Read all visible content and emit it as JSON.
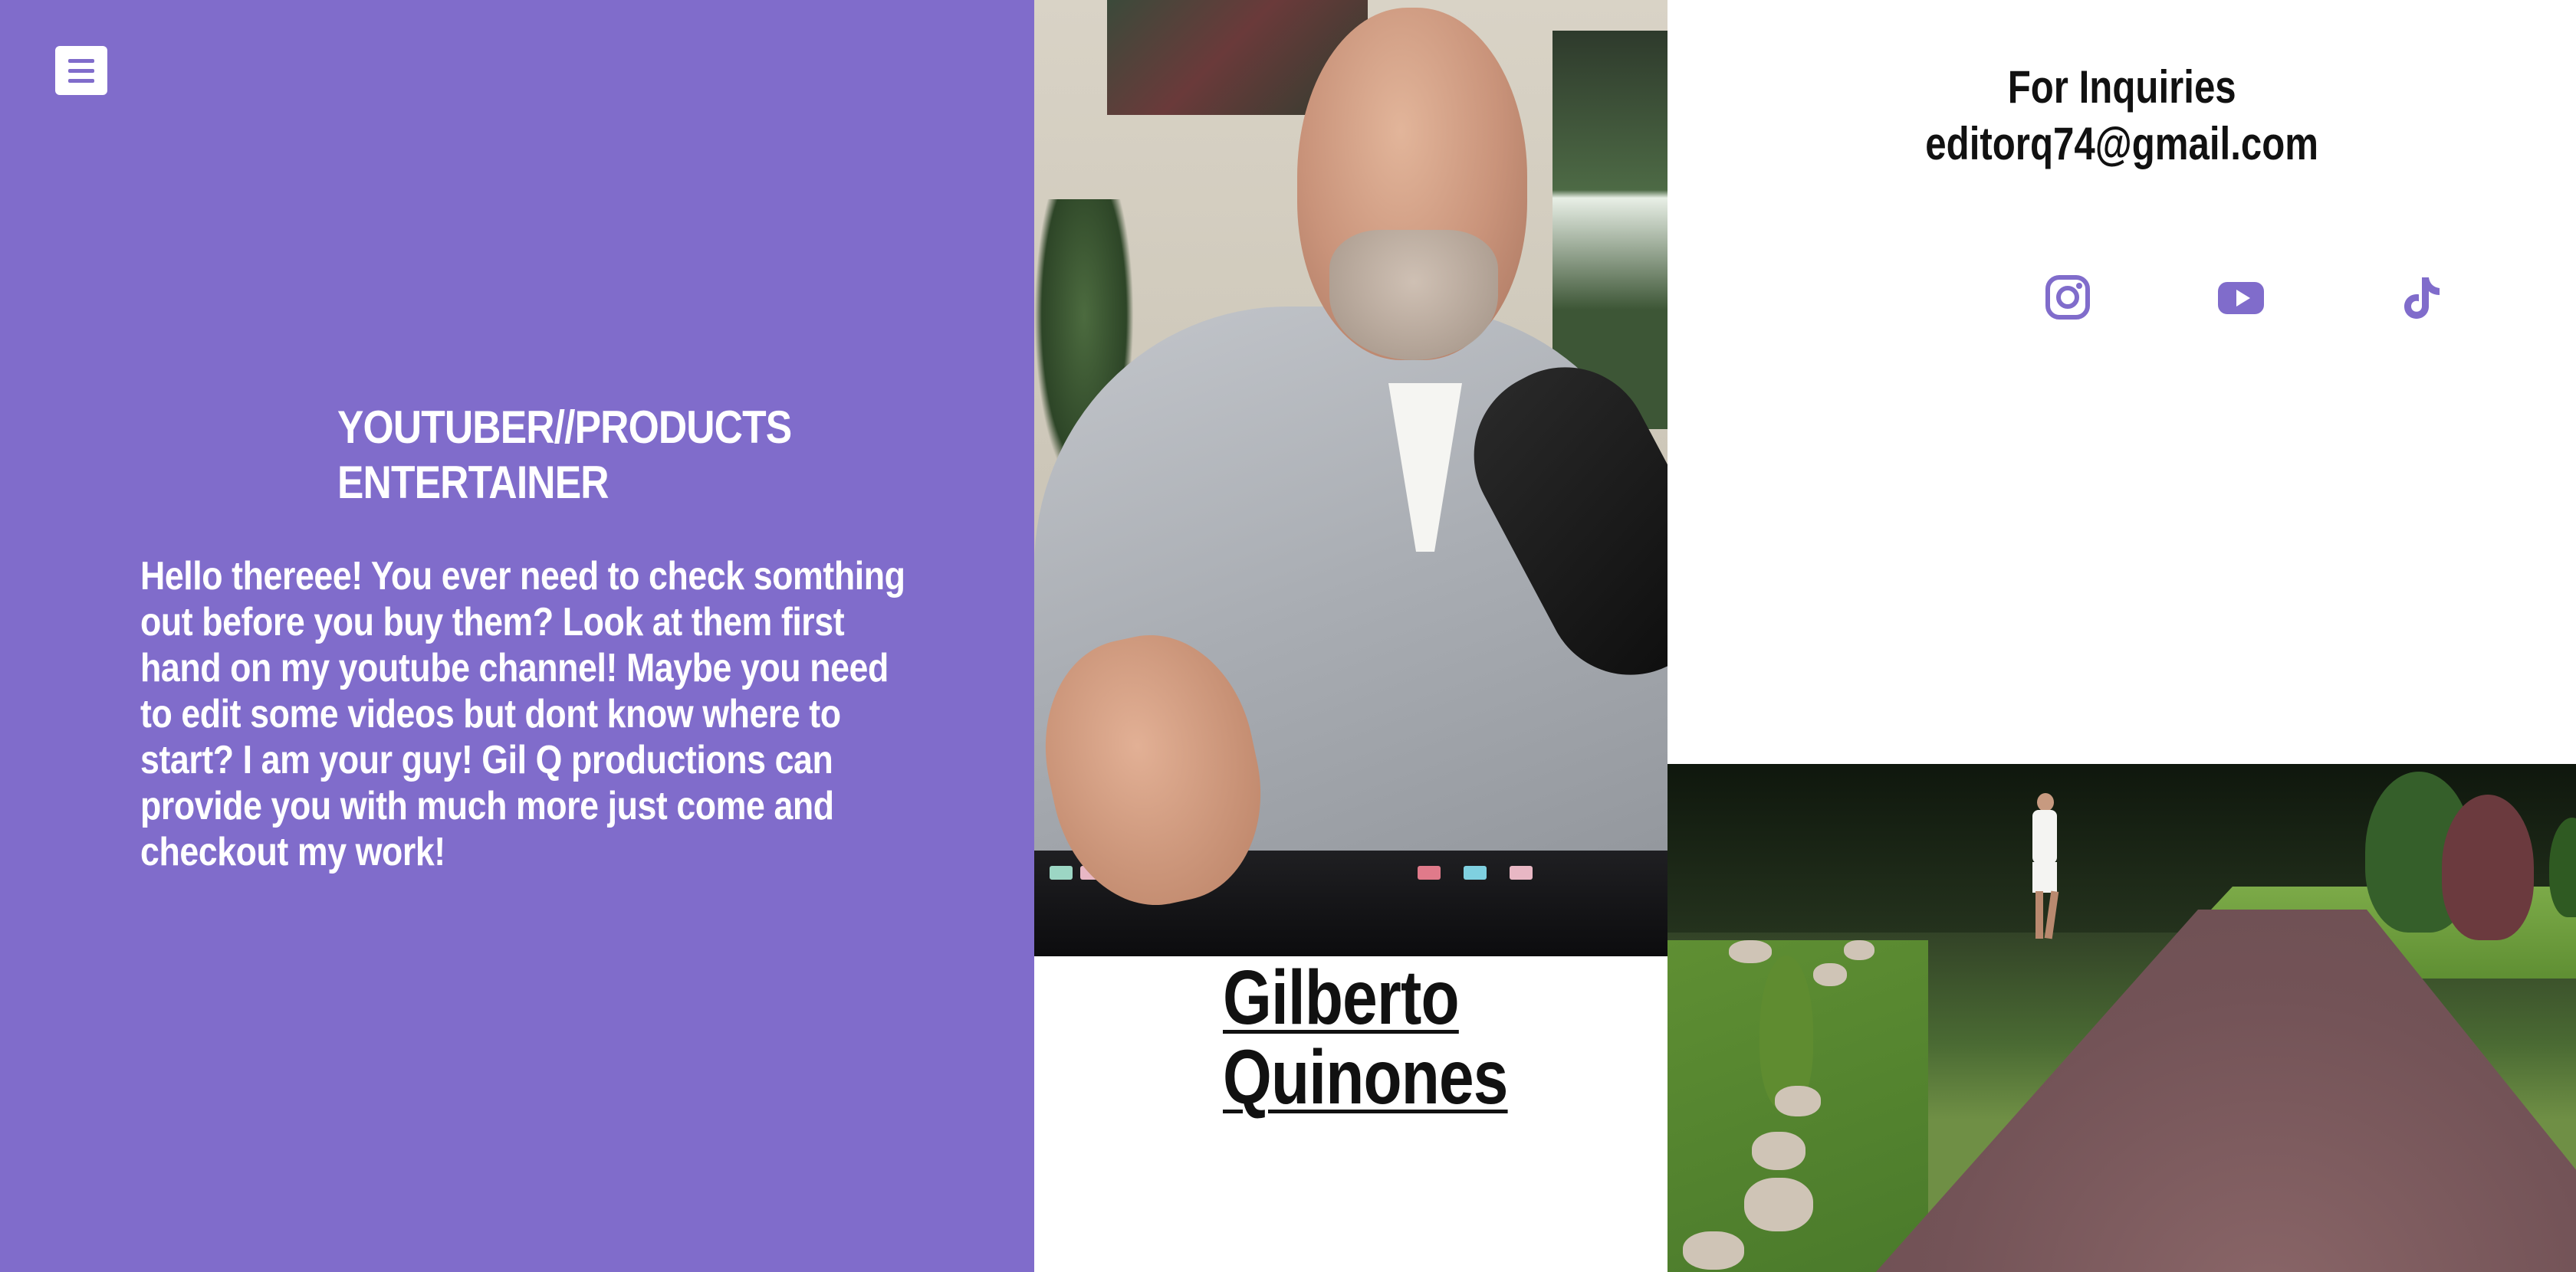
{
  "menu": {
    "icon": "hamburger-menu-icon"
  },
  "left": {
    "tagline_line1": "YOUTUBER//PRODUCTS",
    "tagline_line2": "ENTERTAINER",
    "intro": "Hello thereee! You ever need to check somthing out before you buy them? Look at them first hand on my youtube channel! Maybe you need to edit some videos but dont know where to start? I am your guy! Gil Q productions can provide you with much more just come and checkout my work!",
    "background_color": "#806ccb"
  },
  "center": {
    "name_line1": "Gilberto",
    "name_line2": "Quinones"
  },
  "right": {
    "inquiries_title": "For Inquiries",
    "email": "editorq74@gmail.com",
    "social": [
      {
        "icon": "instagram-icon"
      },
      {
        "icon": "youtube-icon"
      },
      {
        "icon": "tiktok-icon"
      }
    ],
    "accent_color": "#806ccb"
  }
}
